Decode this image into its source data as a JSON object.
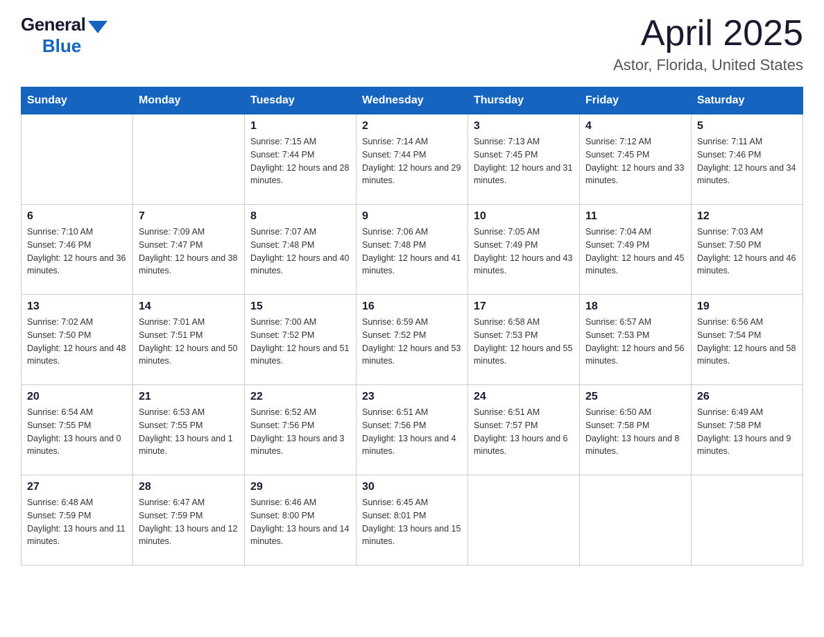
{
  "header": {
    "logo": {
      "general": "General",
      "blue": "Blue"
    },
    "title": "April 2025",
    "location": "Astor, Florida, United States"
  },
  "calendar": {
    "days_of_week": [
      "Sunday",
      "Monday",
      "Tuesday",
      "Wednesday",
      "Thursday",
      "Friday",
      "Saturday"
    ],
    "weeks": [
      [
        {
          "day": "",
          "info": ""
        },
        {
          "day": "",
          "info": ""
        },
        {
          "day": "1",
          "sunrise": "Sunrise: 7:15 AM",
          "sunset": "Sunset: 7:44 PM",
          "daylight": "Daylight: 12 hours and 28 minutes."
        },
        {
          "day": "2",
          "sunrise": "Sunrise: 7:14 AM",
          "sunset": "Sunset: 7:44 PM",
          "daylight": "Daylight: 12 hours and 29 minutes."
        },
        {
          "day": "3",
          "sunrise": "Sunrise: 7:13 AM",
          "sunset": "Sunset: 7:45 PM",
          "daylight": "Daylight: 12 hours and 31 minutes."
        },
        {
          "day": "4",
          "sunrise": "Sunrise: 7:12 AM",
          "sunset": "Sunset: 7:45 PM",
          "daylight": "Daylight: 12 hours and 33 minutes."
        },
        {
          "day": "5",
          "sunrise": "Sunrise: 7:11 AM",
          "sunset": "Sunset: 7:46 PM",
          "daylight": "Daylight: 12 hours and 34 minutes."
        }
      ],
      [
        {
          "day": "6",
          "sunrise": "Sunrise: 7:10 AM",
          "sunset": "Sunset: 7:46 PM",
          "daylight": "Daylight: 12 hours and 36 minutes."
        },
        {
          "day": "7",
          "sunrise": "Sunrise: 7:09 AM",
          "sunset": "Sunset: 7:47 PM",
          "daylight": "Daylight: 12 hours and 38 minutes."
        },
        {
          "day": "8",
          "sunrise": "Sunrise: 7:07 AM",
          "sunset": "Sunset: 7:48 PM",
          "daylight": "Daylight: 12 hours and 40 minutes."
        },
        {
          "day": "9",
          "sunrise": "Sunrise: 7:06 AM",
          "sunset": "Sunset: 7:48 PM",
          "daylight": "Daylight: 12 hours and 41 minutes."
        },
        {
          "day": "10",
          "sunrise": "Sunrise: 7:05 AM",
          "sunset": "Sunset: 7:49 PM",
          "daylight": "Daylight: 12 hours and 43 minutes."
        },
        {
          "day": "11",
          "sunrise": "Sunrise: 7:04 AM",
          "sunset": "Sunset: 7:49 PM",
          "daylight": "Daylight: 12 hours and 45 minutes."
        },
        {
          "day": "12",
          "sunrise": "Sunrise: 7:03 AM",
          "sunset": "Sunset: 7:50 PM",
          "daylight": "Daylight: 12 hours and 46 minutes."
        }
      ],
      [
        {
          "day": "13",
          "sunrise": "Sunrise: 7:02 AM",
          "sunset": "Sunset: 7:50 PM",
          "daylight": "Daylight: 12 hours and 48 minutes."
        },
        {
          "day": "14",
          "sunrise": "Sunrise: 7:01 AM",
          "sunset": "Sunset: 7:51 PM",
          "daylight": "Daylight: 12 hours and 50 minutes."
        },
        {
          "day": "15",
          "sunrise": "Sunrise: 7:00 AM",
          "sunset": "Sunset: 7:52 PM",
          "daylight": "Daylight: 12 hours and 51 minutes."
        },
        {
          "day": "16",
          "sunrise": "Sunrise: 6:59 AM",
          "sunset": "Sunset: 7:52 PM",
          "daylight": "Daylight: 12 hours and 53 minutes."
        },
        {
          "day": "17",
          "sunrise": "Sunrise: 6:58 AM",
          "sunset": "Sunset: 7:53 PM",
          "daylight": "Daylight: 12 hours and 55 minutes."
        },
        {
          "day": "18",
          "sunrise": "Sunrise: 6:57 AM",
          "sunset": "Sunset: 7:53 PM",
          "daylight": "Daylight: 12 hours and 56 minutes."
        },
        {
          "day": "19",
          "sunrise": "Sunrise: 6:56 AM",
          "sunset": "Sunset: 7:54 PM",
          "daylight": "Daylight: 12 hours and 58 minutes."
        }
      ],
      [
        {
          "day": "20",
          "sunrise": "Sunrise: 6:54 AM",
          "sunset": "Sunset: 7:55 PM",
          "daylight": "Daylight: 13 hours and 0 minutes."
        },
        {
          "day": "21",
          "sunrise": "Sunrise: 6:53 AM",
          "sunset": "Sunset: 7:55 PM",
          "daylight": "Daylight: 13 hours and 1 minute."
        },
        {
          "day": "22",
          "sunrise": "Sunrise: 6:52 AM",
          "sunset": "Sunset: 7:56 PM",
          "daylight": "Daylight: 13 hours and 3 minutes."
        },
        {
          "day": "23",
          "sunrise": "Sunrise: 6:51 AM",
          "sunset": "Sunset: 7:56 PM",
          "daylight": "Daylight: 13 hours and 4 minutes."
        },
        {
          "day": "24",
          "sunrise": "Sunrise: 6:51 AM",
          "sunset": "Sunset: 7:57 PM",
          "daylight": "Daylight: 13 hours and 6 minutes."
        },
        {
          "day": "25",
          "sunrise": "Sunrise: 6:50 AM",
          "sunset": "Sunset: 7:58 PM",
          "daylight": "Daylight: 13 hours and 8 minutes."
        },
        {
          "day": "26",
          "sunrise": "Sunrise: 6:49 AM",
          "sunset": "Sunset: 7:58 PM",
          "daylight": "Daylight: 13 hours and 9 minutes."
        }
      ],
      [
        {
          "day": "27",
          "sunrise": "Sunrise: 6:48 AM",
          "sunset": "Sunset: 7:59 PM",
          "daylight": "Daylight: 13 hours and 11 minutes."
        },
        {
          "day": "28",
          "sunrise": "Sunrise: 6:47 AM",
          "sunset": "Sunset: 7:59 PM",
          "daylight": "Daylight: 13 hours and 12 minutes."
        },
        {
          "day": "29",
          "sunrise": "Sunrise: 6:46 AM",
          "sunset": "Sunset: 8:00 PM",
          "daylight": "Daylight: 13 hours and 14 minutes."
        },
        {
          "day": "30",
          "sunrise": "Sunrise: 6:45 AM",
          "sunset": "Sunset: 8:01 PM",
          "daylight": "Daylight: 13 hours and 15 minutes."
        },
        {
          "day": "",
          "info": ""
        },
        {
          "day": "",
          "info": ""
        },
        {
          "day": "",
          "info": ""
        }
      ]
    ]
  }
}
